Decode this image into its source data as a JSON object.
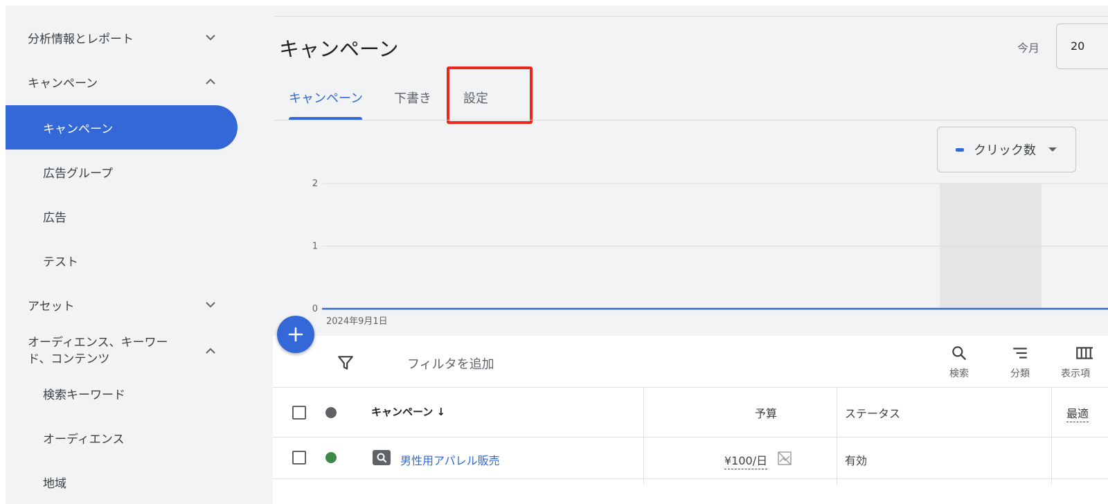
{
  "sidebar": {
    "items": [
      {
        "label": "分析情報とレポート",
        "type": "group",
        "chevron": "down"
      },
      {
        "label": "キャンペーン",
        "type": "group",
        "chevron": "up"
      },
      {
        "label": "キャンペーン",
        "type": "sub",
        "active": true
      },
      {
        "label": "広告グループ",
        "type": "sub"
      },
      {
        "label": "広告",
        "type": "sub"
      },
      {
        "label": "テスト",
        "type": "sub"
      },
      {
        "label": "アセット",
        "type": "group",
        "chevron": "down"
      },
      {
        "label": "オーディエンス、キーワード、コンテンツ",
        "label_line1": "オーディエンス、キーワー",
        "label_line2": "ド、コンテンツ",
        "type": "group",
        "chevron": "up"
      },
      {
        "label": "検索キーワード",
        "type": "sub"
      },
      {
        "label": "オーディエンス",
        "type": "sub"
      },
      {
        "label": "地域",
        "type": "sub"
      }
    ]
  },
  "header": {
    "title": "キャンペーン",
    "month_label": "今月",
    "date_value": "20"
  },
  "tabs": [
    {
      "label": "キャンペーン",
      "active": true
    },
    {
      "label": "下書き",
      "active": false
    },
    {
      "label": "設定",
      "active": false,
      "highlighted": true
    }
  ],
  "metric_selector": {
    "label": "クリック数"
  },
  "chart_data": {
    "type": "line",
    "series": [
      {
        "name": "クリック数",
        "values": [
          0,
          0
        ]
      }
    ],
    "x": [
      "2024年9月1日",
      ""
    ],
    "y_ticks": [
      0,
      1,
      2
    ],
    "ylim": [
      0,
      2
    ],
    "x_start_label": "2024年9月1日",
    "colors": {
      "line": "#3468d6",
      "grid": "#dadce0",
      "shaded": "#e3e5e7"
    }
  },
  "toolbar": {
    "filter_placeholder": "フィルタを追加",
    "search_label": "検索",
    "segment_label": "分類",
    "columns_label": "表示項"
  },
  "table": {
    "headers": {
      "campaign": "キャンペーン ↓",
      "budget": "予算",
      "status": "ステータス",
      "optimization": "最適"
    },
    "rows": [
      {
        "campaign": "男性用アパレル販売",
        "budget": "¥100/日",
        "status": "有効",
        "status_color": "#3c8a46"
      }
    ]
  },
  "colors": {
    "accent": "#3468d6",
    "highlight": "#e8291c",
    "background": "#f1f3f4"
  }
}
